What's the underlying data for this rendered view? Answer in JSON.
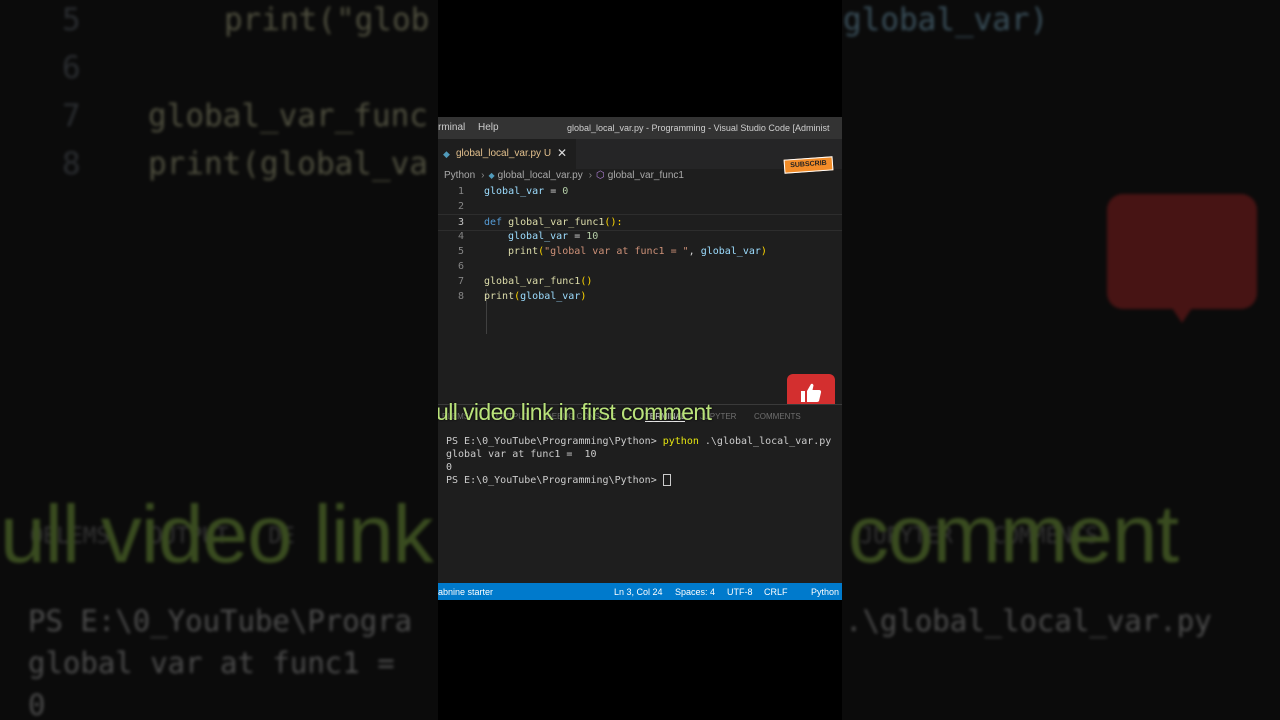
{
  "menu": {
    "terminal": "rminal",
    "help": "Help"
  },
  "window_title": "global_local_var.py - Programming - Visual Studio Code [Administ",
  "tab": {
    "name": "global_local_var.py U",
    "close": "✕"
  },
  "subscribe_label": "SUBSCRIB",
  "breadcrumb": {
    "root": "Python",
    "file": "global_local_var.py",
    "symbol": "global_var_func1"
  },
  "line_numbers": [
    "1",
    "2",
    "3",
    "4",
    "5",
    "6",
    "7",
    "8"
  ],
  "code": {
    "l1_var": "global_var",
    "l1_rest": " = ",
    "l1_num": "0",
    "l3_def": "def",
    "l3_name": "global_var_func1",
    "l3_rest": "():",
    "l4_var": "global_var",
    "l4_rest": " = ",
    "l4_num": "10",
    "l5_fn": "print",
    "l5_open": "(",
    "l5_str": "\"global var at func1 = \"",
    "l5_comma": ", ",
    "l5_var": "global_var",
    "l5_close": ")",
    "l7_fn": "global_var_func1",
    "l7_rest": "()",
    "l8_fn": "print",
    "l8_open": "(",
    "l8_var": "global_var",
    "l8_close": ")"
  },
  "panel_tabs": [
    "BLEMS",
    "OUTPUT",
    "DEBUG CONSOLE",
    "TERMINAL",
    "JUPYTER",
    "COMMENTS"
  ],
  "caption": "ull video link in first comment",
  "terminal": {
    "prompt1": "PS E:\\0_YouTube\\Programming\\Python> ",
    "cmd": "python",
    "cmd_arg": " .\\global_local_var.py",
    "out1": "global var at func1 =  10",
    "out2": "0",
    "prompt2": "PS E:\\0_YouTube\\Programming\\Python> "
  },
  "status": {
    "left": "abnine starter",
    "position": "Ln 3, Col 24",
    "spaces": "Spaces: 4",
    "encoding": "UTF-8",
    "eol": "CRLF",
    "language": "Python"
  },
  "background": {
    "line5": "print(\"glob",
    "line5_right": "global_var)",
    "line7": "global_var_func",
    "line8": "print(global_va",
    "num5": "5",
    "num6": "6",
    "num7": "7",
    "num8": "8",
    "caption_left": "ull video link",
    "caption_right": "comment",
    "tabs_left": "OBLEMS   OUTPUT   DE",
    "tabs_right": "JUPYTER   COMMENTS",
    "term1": "PS E:\\0_YouTube\\Progra",
    "term1_right": ".\\global_local_var.py",
    "term2": "global var at func1 =",
    "term3": "0"
  },
  "icons": [
    "python-file-icon",
    "close-icon",
    "chevron-right-icon",
    "function-icon",
    "like-icon"
  ],
  "colors": {
    "statusbar": "#007acc",
    "accent_red": "#d32f2f",
    "caption": "#b9e27a"
  }
}
